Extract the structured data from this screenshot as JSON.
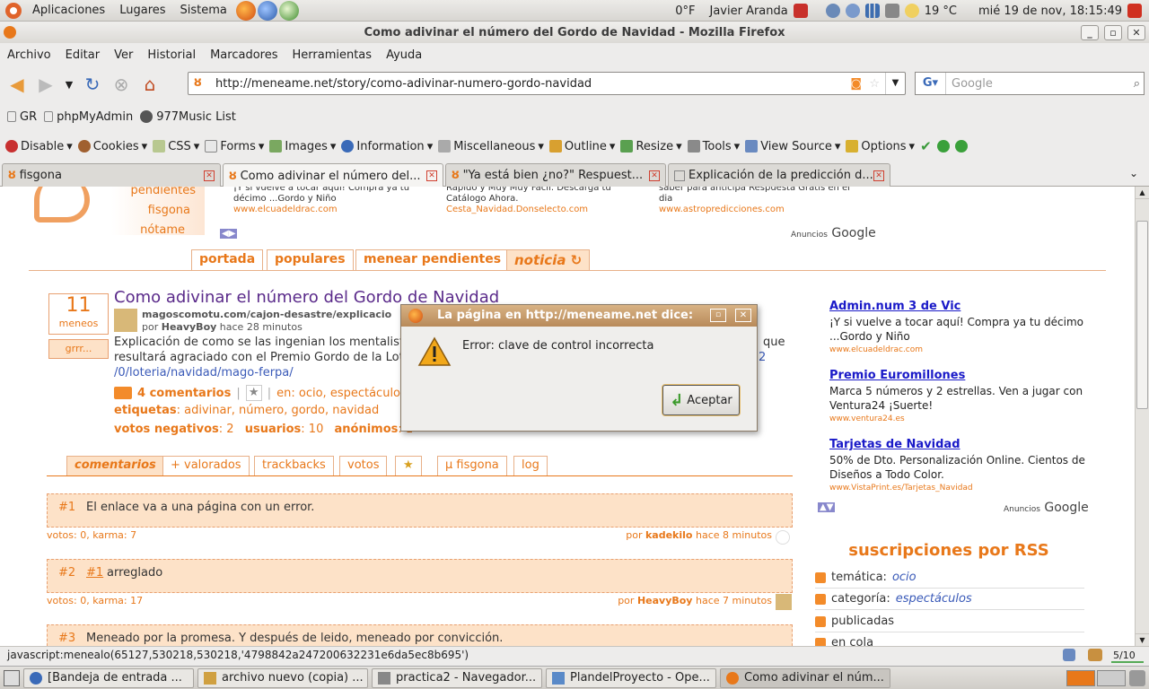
{
  "top_panel": {
    "menus": [
      "Aplicaciones",
      "Lugares",
      "Sistema"
    ],
    "temp_f": "0°F",
    "user": "Javier Aranda",
    "weather": "19 °C",
    "clock": "mié 19 de nov, 18:15:49"
  },
  "window": {
    "title": "Como adivinar el número del Gordo de Navidad - Mozilla Firefox"
  },
  "menubar": [
    "Archivo",
    "Editar",
    "Ver",
    "Historial",
    "Marcadores",
    "Herramientas",
    "Ayuda"
  ],
  "navbar": {
    "url": "http://meneame.net/story/como-adivinar-numero-gordo-navidad",
    "search_placeholder": "Google"
  },
  "bookmarks": [
    "GR",
    "phpMyAdmin",
    "977Music List"
  ],
  "webdev": [
    "Disable",
    "Cookies",
    "CSS",
    "Forms",
    "Images",
    "Information",
    "Miscellaneous",
    "Outline",
    "Resize",
    "Tools",
    "View Source",
    "Options"
  ],
  "tabs": [
    {
      "label": "fisgona"
    },
    {
      "label": "Como adivinar el número del..."
    },
    {
      "label": "\"Ya está bien ¿no?\" Respuest..."
    },
    {
      "label": "Explicación de la predicción d..."
    }
  ],
  "page": {
    "side_links": [
      "pendientes",
      "fisgona",
      "nótame"
    ],
    "top_ads": [
      {
        "text": "¡Y si vuelve a tocar aquí! Compra ya tu décimo ...Gordo y Niño",
        "url": "www.elcuadeldrac.com"
      },
      {
        "text": "Rápido y Muy Muy Fácil. Descarga tu Catálogo Ahora.",
        "url": "Cesta_Navidad.Donselecto.com"
      },
      {
        "text": "saber para anticipa Respuesta Gratis en el dia",
        "url": "www.astropredicciones.com"
      }
    ],
    "ads_by": "Anuncios",
    "google": "Google",
    "nav_tabs": [
      "portada",
      "populares",
      "menear pendientes",
      "noticia"
    ],
    "story": {
      "votes": "11",
      "votes_label": "meneos",
      "grr": "grrr...",
      "title": "Como adivinar el número del Gordo de Navidad",
      "source": "magoscomotu.com/cajon-desastre/explicacio",
      "by_prefix": "por",
      "author": "HeavyBoy",
      "time": "hace 28 minutos",
      "body1": "Explicación de como se las ingenian los mentalista",
      "body1_tail": "que",
      "body2": "resultará agraciado con el Premio Gordo de la Lote",
      "body2_tail": "2",
      "link_tail": "/0/loteria/navidad/mago-ferpa/",
      "comments": "4 comentarios",
      "category_label": "en: ocio, espectáculos",
      "tags_label": "etiquetas",
      "tags": "adivinar, número, gordo, navidad",
      "neg_label": "votos negativos",
      "neg": "2",
      "users_label": "usuarios",
      "users": "10",
      "anon_label": "anónimos",
      "anon": "1"
    },
    "comment_tabs": [
      "comentarios",
      "+ valorados",
      "trackbacks",
      "votos",
      "μ fisgona",
      "log"
    ],
    "comments": [
      {
        "num": "#1",
        "ref": "",
        "text": "El enlace va a una página con un error.",
        "meta": "votos: 0, karma: 7",
        "author": "kadekilo",
        "time": "hace 8 minutos"
      },
      {
        "num": "#2",
        "ref": "#1",
        "text": "arreglado",
        "meta": "votos: 0, karma: 17",
        "author": "HeavyBoy",
        "time": "hace 7 minutos"
      },
      {
        "num": "#3",
        "ref": "",
        "text": "Meneado por la promesa. Y después de leido, meneado por convicción.",
        "meta": "",
        "author": "",
        "time": ""
      }
    ],
    "right_ads": [
      {
        "title": "Admin.num 3 de Vic",
        "text": "¡Y si vuelve a tocar aquí! Compra ya tu décimo ...Gordo y Niño",
        "url": "www.elcuadeldrac.com"
      },
      {
        "title": "Premio Euromillones",
        "text": "Marca 5 números y 2 estrellas. Ven a jugar con Ventura24 ¡Suerte!",
        "url": "www.ventura24.es"
      },
      {
        "title": "Tarjetas de Navidad",
        "text": "50% de Dto. Personalización Online. Cientos de Diseños a Todo Color.",
        "url": "www.VistaPrint.es/Tarjetas_Navidad"
      }
    ],
    "rss_heading": "suscripciones por RSS",
    "rss": [
      {
        "label": "temática:",
        "value": "ocio"
      },
      {
        "label": "categoría:",
        "value": "espectáculos"
      },
      {
        "label": "publicadas",
        "value": ""
      },
      {
        "label": "en cola",
        "value": ""
      }
    ]
  },
  "dialog": {
    "title": "La página en http://meneame.net dice:",
    "message": "Error: clave de control incorrecta",
    "ok": "Aceptar"
  },
  "statusbar": {
    "text": "javascript:menealo(65127,530218,530218,'4798842a247200632231e6da5ec8b695')",
    "count": "5/10"
  },
  "taskbar": [
    "[Bandeja de entrada ...",
    "archivo nuevo (copia) ...",
    "practica2 - Navegador...",
    "PlandelProyecto - Ope...",
    "Como adivinar el núm..."
  ]
}
